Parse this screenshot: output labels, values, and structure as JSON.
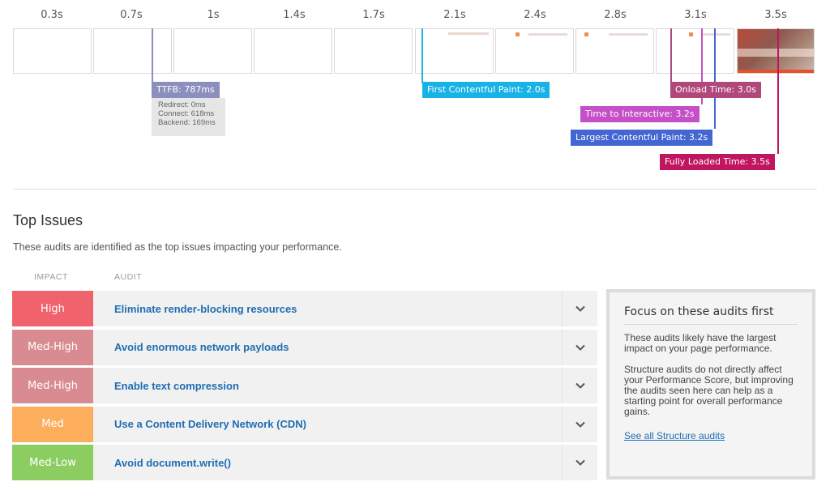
{
  "timeline": {
    "ticks": [
      "0.3s",
      "0.7s",
      "1s",
      "1.4s",
      "1.7s",
      "2.1s",
      "2.4s",
      "2.8s",
      "3.1s",
      "3.5s"
    ],
    "markers": {
      "ttfb": {
        "label": "TTFB: 787ms",
        "color": "#8a8fbd"
      },
      "fcp": {
        "label": "First Contentful Paint: 2.0s",
        "color": "#17b3e6"
      },
      "onload": {
        "label": "Onload Time: 3.0s",
        "color": "#b0487c"
      },
      "tti": {
        "label": "Time to Interactive: 3.2s",
        "color": "#c44fc7"
      },
      "lcp": {
        "label": "Largest Contentful Paint: 3.2s",
        "color": "#4466d3"
      },
      "fully": {
        "label": "Fully Loaded Time: 3.5s",
        "color": "#c0155f"
      }
    },
    "ttfb_details": [
      "Redirect: 0ms",
      "Connect: 618ms",
      "Backend: 169ms"
    ]
  },
  "top_issues": {
    "title": "Top Issues",
    "description": "These audits are identified as the top issues impacting your performance.",
    "columns": {
      "impact": "IMPACT",
      "audit": "AUDIT"
    },
    "rows": [
      {
        "impact": "High",
        "color": "#f0636d",
        "audit": "Eliminate render-blocking resources"
      },
      {
        "impact": "Med-High",
        "color": "#d98b92",
        "audit": "Avoid enormous network payloads"
      },
      {
        "impact": "Med-High",
        "color": "#d98b92",
        "audit": "Enable text compression"
      },
      {
        "impact": "Med",
        "color": "#fcae5c",
        "audit": "Use a Content Delivery Network (CDN)"
      },
      {
        "impact": "Med-Low",
        "color": "#8ccd62",
        "audit": "Avoid document.write()"
      }
    ]
  },
  "focus_panel": {
    "title": "Focus on these audits first",
    "p1": "These audits likely have the largest impact on your page performance.",
    "p2": "Structure audits do not directly affect your Performance Score, but improving the audits seen here can help as a starting point for overall performance gains.",
    "link": "See all Structure audits"
  },
  "icons": {
    "expand": "chevron-down-icon"
  }
}
